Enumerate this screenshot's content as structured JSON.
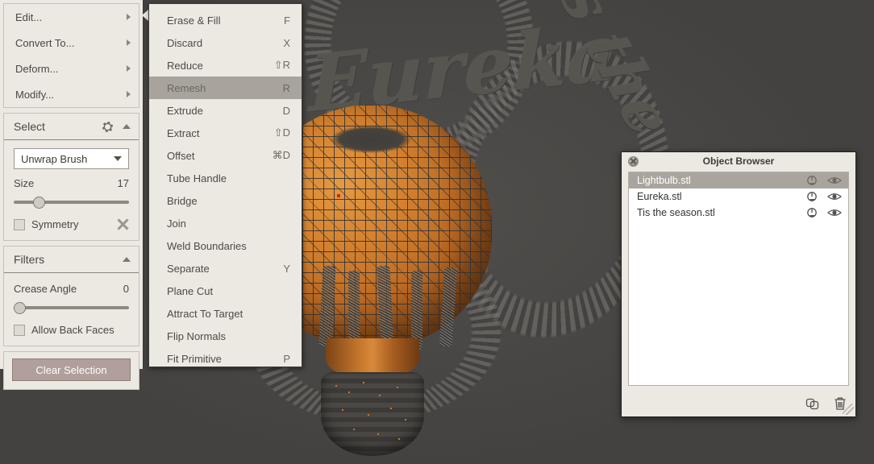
{
  "viewport": {
    "name": "3d-viewport",
    "background_color": "#444240",
    "mesh_color": "#d4822f",
    "wireframe_color": "#2d2f32",
    "selection_marker_color": "#e01b1b",
    "scene_words": [
      "Eureka",
      "Tis the season"
    ]
  },
  "left_panel": {
    "menu_items": [
      {
        "label": "Edit...",
        "icon": "chevron-right-icon"
      },
      {
        "label": "Convert To...",
        "icon": "chevron-right-icon"
      },
      {
        "label": "Deform...",
        "icon": "chevron-right-icon"
      },
      {
        "label": "Modify...",
        "icon": "chevron-right-icon"
      }
    ],
    "select_section": {
      "title": "Select",
      "gear_icon": "gear-icon",
      "collapse_icon": "chevron-up-icon",
      "brush": {
        "value": "Unwrap Brush",
        "dropdown_icon": "chevron-down-icon"
      },
      "size": {
        "label": "Size",
        "value": "17",
        "slider_percent": 17
      },
      "symmetry": {
        "label": "Symmetry",
        "checked": false,
        "tool_icon": "wrench-icon"
      }
    },
    "filters_section": {
      "title": "Filters",
      "collapse_icon": "chevron-up-icon",
      "crease_angle": {
        "label": "Crease Angle",
        "value": "0",
        "slider_percent": 0
      },
      "allow_back_faces": {
        "label": "Allow Back Faces",
        "checked": false
      }
    },
    "clear_selection_button": {
      "label": "Clear Selection",
      "color": "#b09f9b"
    }
  },
  "context_menu": {
    "name": "edit-context-menu",
    "highlighted": "Remesh",
    "items": [
      {
        "label": "Erase & Fill",
        "shortcut": "F"
      },
      {
        "label": "Discard",
        "shortcut": "X"
      },
      {
        "label": "Reduce",
        "shortcut": "⇧R"
      },
      {
        "label": "Remesh",
        "shortcut": "R"
      },
      {
        "label": "Extrude",
        "shortcut": "D"
      },
      {
        "label": "Extract",
        "shortcut": "⇧D"
      },
      {
        "label": "Offset",
        "shortcut": "⌘D"
      },
      {
        "label": "Tube Handle",
        "shortcut": ""
      },
      {
        "label": "Bridge",
        "shortcut": ""
      },
      {
        "label": "Join",
        "shortcut": ""
      },
      {
        "label": "Weld Boundaries",
        "shortcut": ""
      },
      {
        "label": "Separate",
        "shortcut": "Y"
      },
      {
        "label": "Plane Cut",
        "shortcut": ""
      },
      {
        "label": "Attract To Target",
        "shortcut": ""
      },
      {
        "label": "Flip Normals",
        "shortcut": ""
      },
      {
        "label": "Fit Primitive",
        "shortcut": "P"
      }
    ]
  },
  "object_browser": {
    "title": "Object Browser",
    "close_icon": "close-icon",
    "rows": [
      {
        "name": "Lightbulb.stl",
        "selected": true,
        "edit_icon": "edit-object-icon",
        "visibility_icon": "eye-icon"
      },
      {
        "name": "Eureka.stl",
        "selected": false,
        "edit_icon": "edit-object-icon",
        "visibility_icon": "eye-icon"
      },
      {
        "name": "Tis the season.stl",
        "selected": false,
        "edit_icon": "edit-object-icon",
        "visibility_icon": "eye-icon"
      }
    ],
    "tools": [
      {
        "name": "duplicate-icon"
      },
      {
        "name": "delete-icon"
      }
    ],
    "resize_grip": "resize-grip-icon"
  }
}
